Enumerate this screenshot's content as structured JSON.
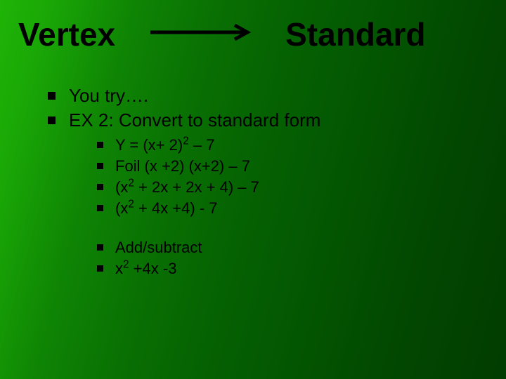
{
  "title": {
    "left": "Vertex",
    "right": "Standard"
  },
  "bullets": {
    "level1": [
      {
        "text": "You try…."
      },
      {
        "text": "EX 2: Convert to standard form"
      }
    ],
    "groupA": [
      {
        "pre": "Y = (x+ 2)",
        "sup": "2",
        "post": " – 7"
      },
      {
        "text": "Foil (x +2) (x+2) – 7"
      },
      {
        "pre": "(x",
        "sup": "2",
        "post": " + 2x + 2x + 4) – 7"
      },
      {
        "pre": "(x",
        "sup": "2",
        "post": " + 4x +4) - 7"
      }
    ],
    "groupB": [
      {
        "text": "Add/subtract"
      },
      {
        "pre": "x",
        "sup": "2",
        "post": " +4x -3"
      }
    ]
  }
}
